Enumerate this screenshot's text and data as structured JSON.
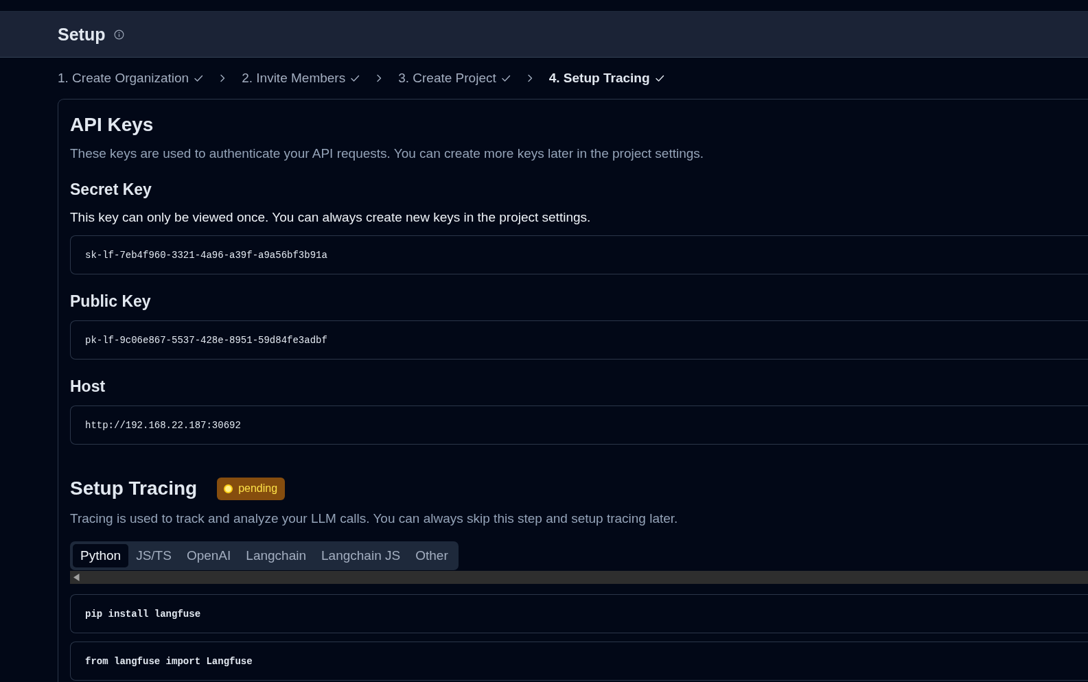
{
  "header": {
    "title": "Setup"
  },
  "steps": [
    {
      "label": "1. Create Organization",
      "selected": false,
      "done": true
    },
    {
      "label": "2. Invite Members",
      "selected": false,
      "done": true
    },
    {
      "label": "3. Create Project",
      "selected": false,
      "done": true
    },
    {
      "label": "4. Setup Tracing",
      "selected": true,
      "done": true
    }
  ],
  "api_keys": {
    "title": "API Keys",
    "description": "These keys are used to authenticate your API requests. You can create more keys later in the project settings.",
    "fields": [
      {
        "label": "Secret Key",
        "note": "This key can only be viewed once. You can always create new keys in the project settings.",
        "value": "sk-lf-7eb4f960-3321-4a96-a39f-a9a56bf3b91a"
      },
      {
        "label": "Public Key",
        "value": "pk-lf-9c06e867-5537-428e-8951-59d84fe3adbf"
      },
      {
        "label": "Host",
        "value": "http://192.168.22.187:30692"
      }
    ]
  },
  "tracing": {
    "title": "Setup Tracing",
    "status": "pending",
    "description": "Tracing is used to track and analyze your LLM calls. You can always skip this step and setup tracing later.",
    "tabs": [
      {
        "label": "Python",
        "selected": true
      },
      {
        "label": "JS/TS",
        "selected": false
      },
      {
        "label": "OpenAI",
        "selected": false
      },
      {
        "label": "Langchain",
        "selected": false
      },
      {
        "label": "Langchain JS",
        "selected": false
      },
      {
        "label": "Other",
        "selected": false
      }
    ],
    "code_blocks": [
      "pip install langfuse",
      "from langfuse import Langfuse"
    ]
  }
}
